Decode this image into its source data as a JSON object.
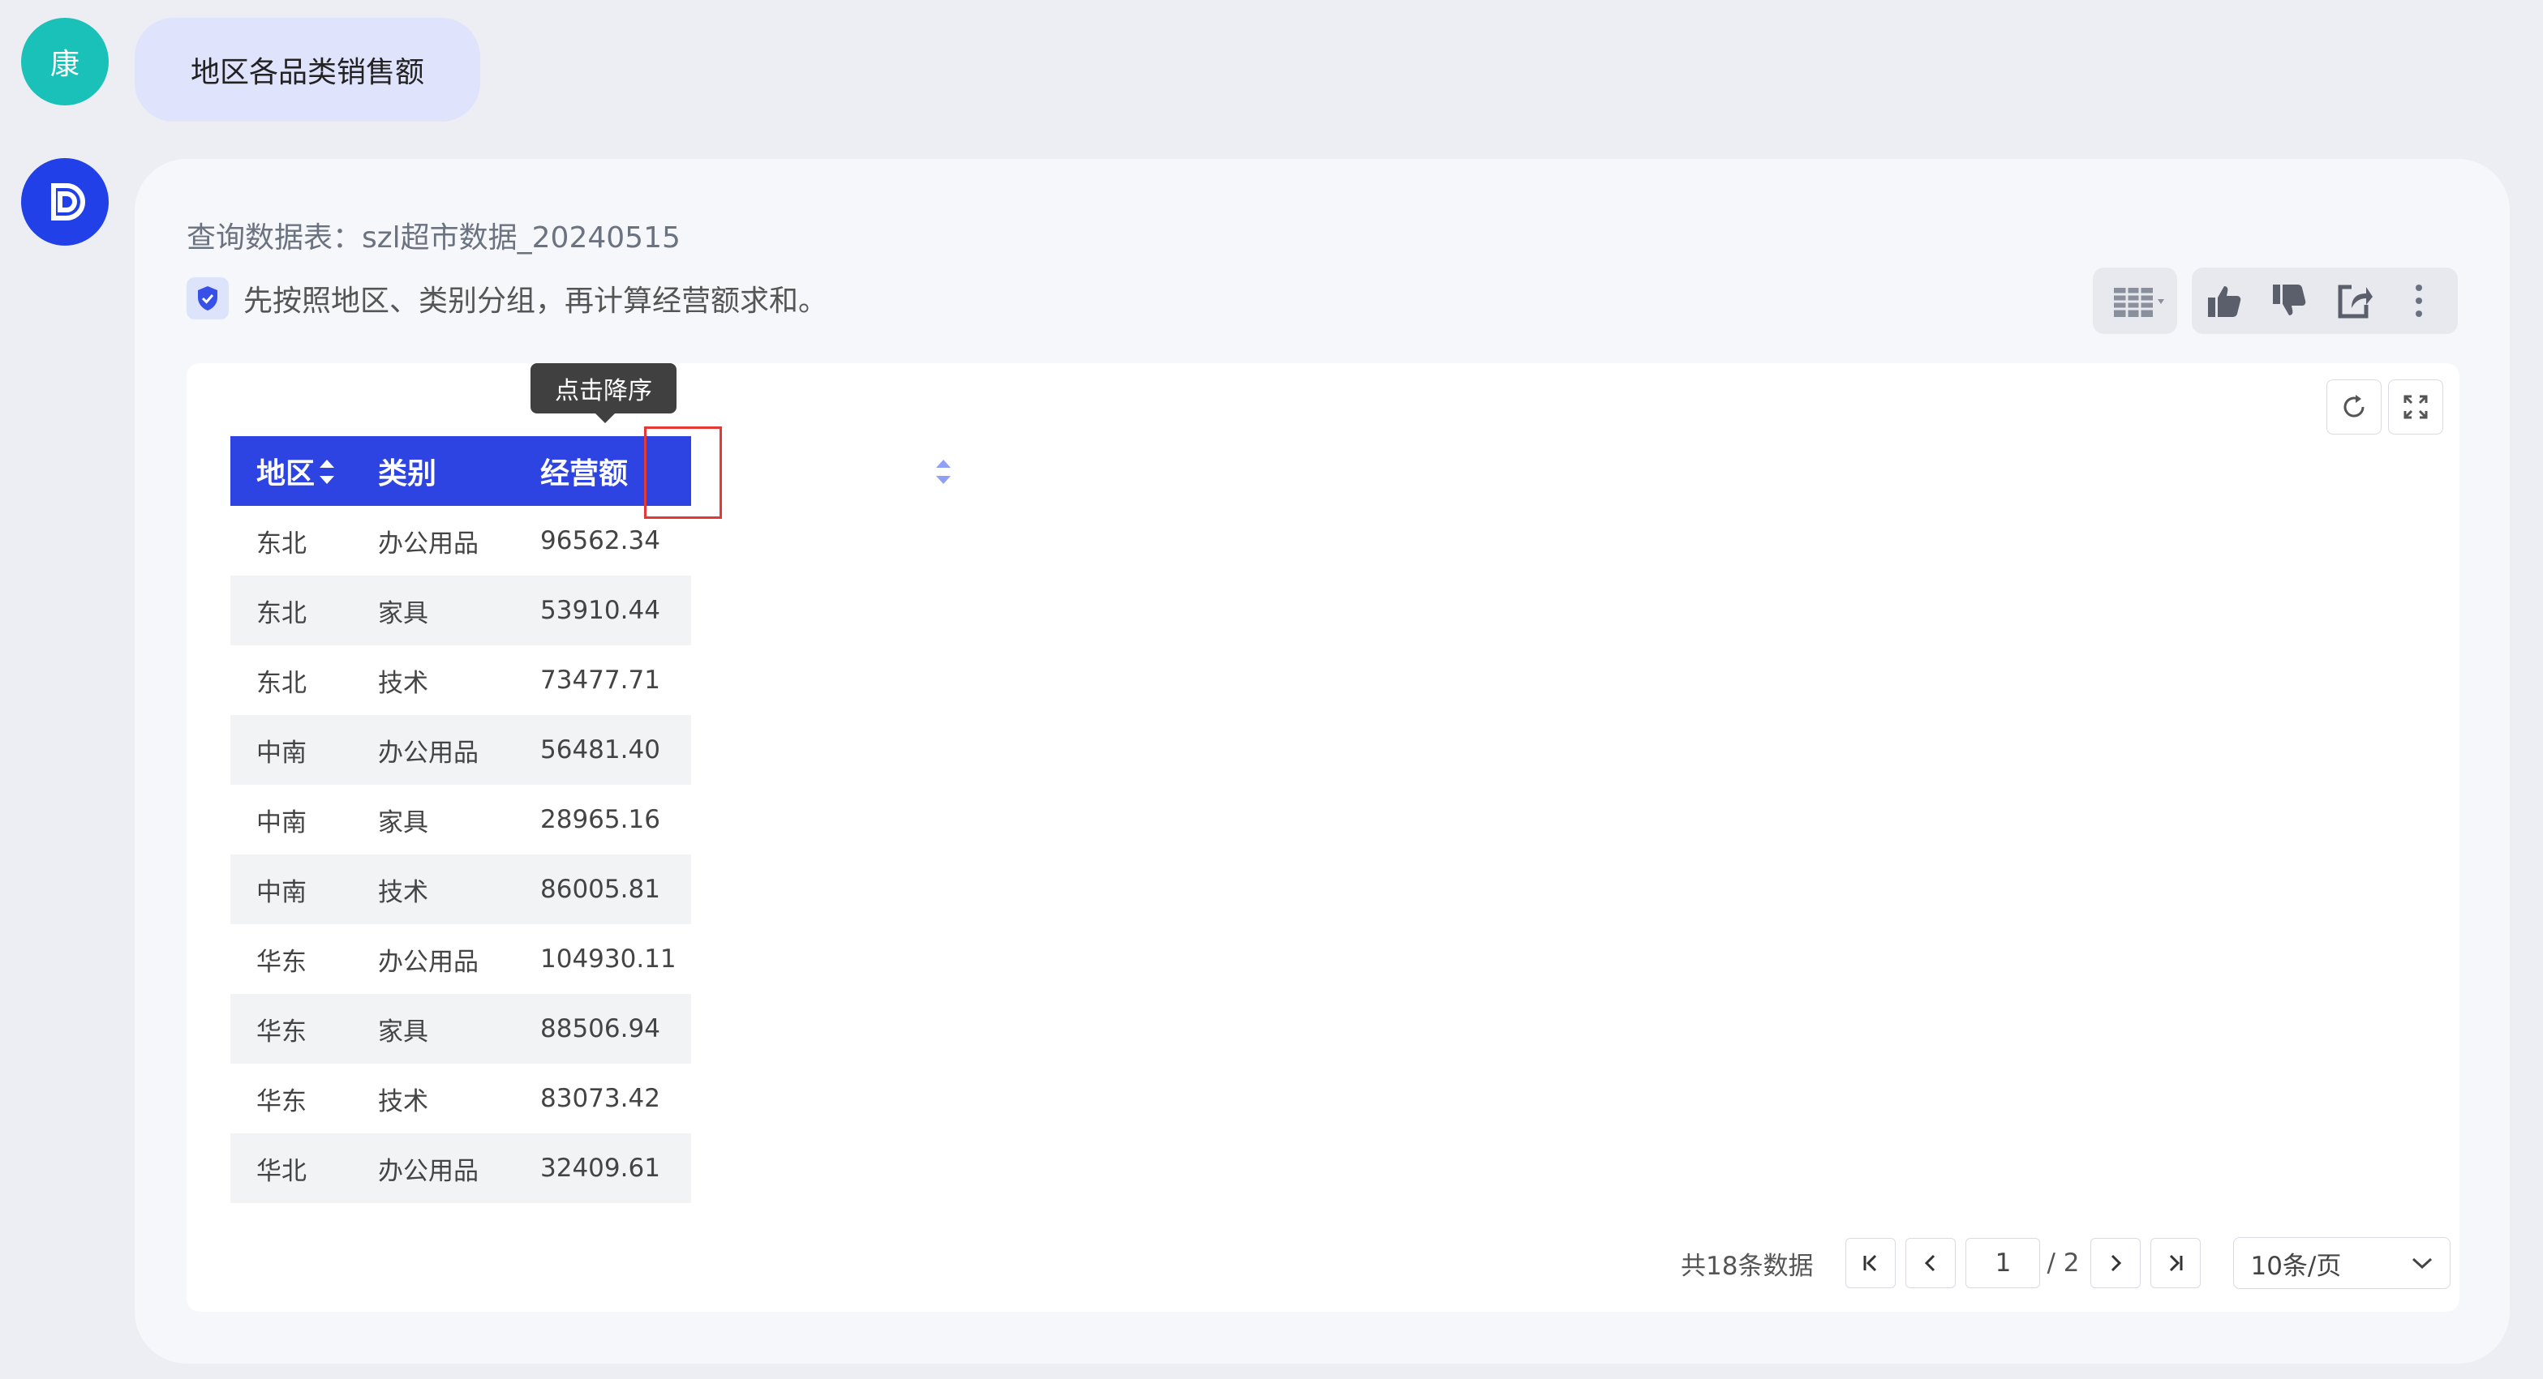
{
  "user": {
    "avatar_text": "康",
    "message": "地区各品类销售额"
  },
  "bot": {
    "query_line": "查询数据表：szl超市数据_20240515",
    "explain": "先按照地区、类别分组，再计算经营额求和。",
    "tooltip": "点击降序"
  },
  "table": {
    "headers": [
      "地区",
      "类别",
      "经营额"
    ],
    "rows": [
      [
        "东北",
        "办公用品",
        "96562.34"
      ],
      [
        "东北",
        "家具",
        "53910.44"
      ],
      [
        "东北",
        "技术",
        "73477.71"
      ],
      [
        "中南",
        "办公用品",
        "56481.40"
      ],
      [
        "中南",
        "家具",
        "28965.16"
      ],
      [
        "中南",
        "技术",
        "86005.81"
      ],
      [
        "华东",
        "办公用品",
        "104930.11"
      ],
      [
        "华东",
        "家具",
        "88506.94"
      ],
      [
        "华东",
        "技术",
        "83073.42"
      ],
      [
        "华北",
        "办公用品",
        "32409.61"
      ]
    ]
  },
  "pagination": {
    "total_text": "共18条数据",
    "current_page": "1",
    "of_text": "/ 2",
    "page_size": "10条/页"
  },
  "colors": {
    "accent": "#2d44e3",
    "user_avatar": "#19c1b8",
    "highlight": "#e53935"
  },
  "icons": {
    "bot_avatar": "logo-icon",
    "toolbar": [
      "table-view-icon",
      "thumbs-up-icon",
      "thumbs-down-icon",
      "share-icon",
      "more-icon"
    ],
    "panel": [
      "refresh-icon",
      "fullscreen-icon"
    ]
  }
}
